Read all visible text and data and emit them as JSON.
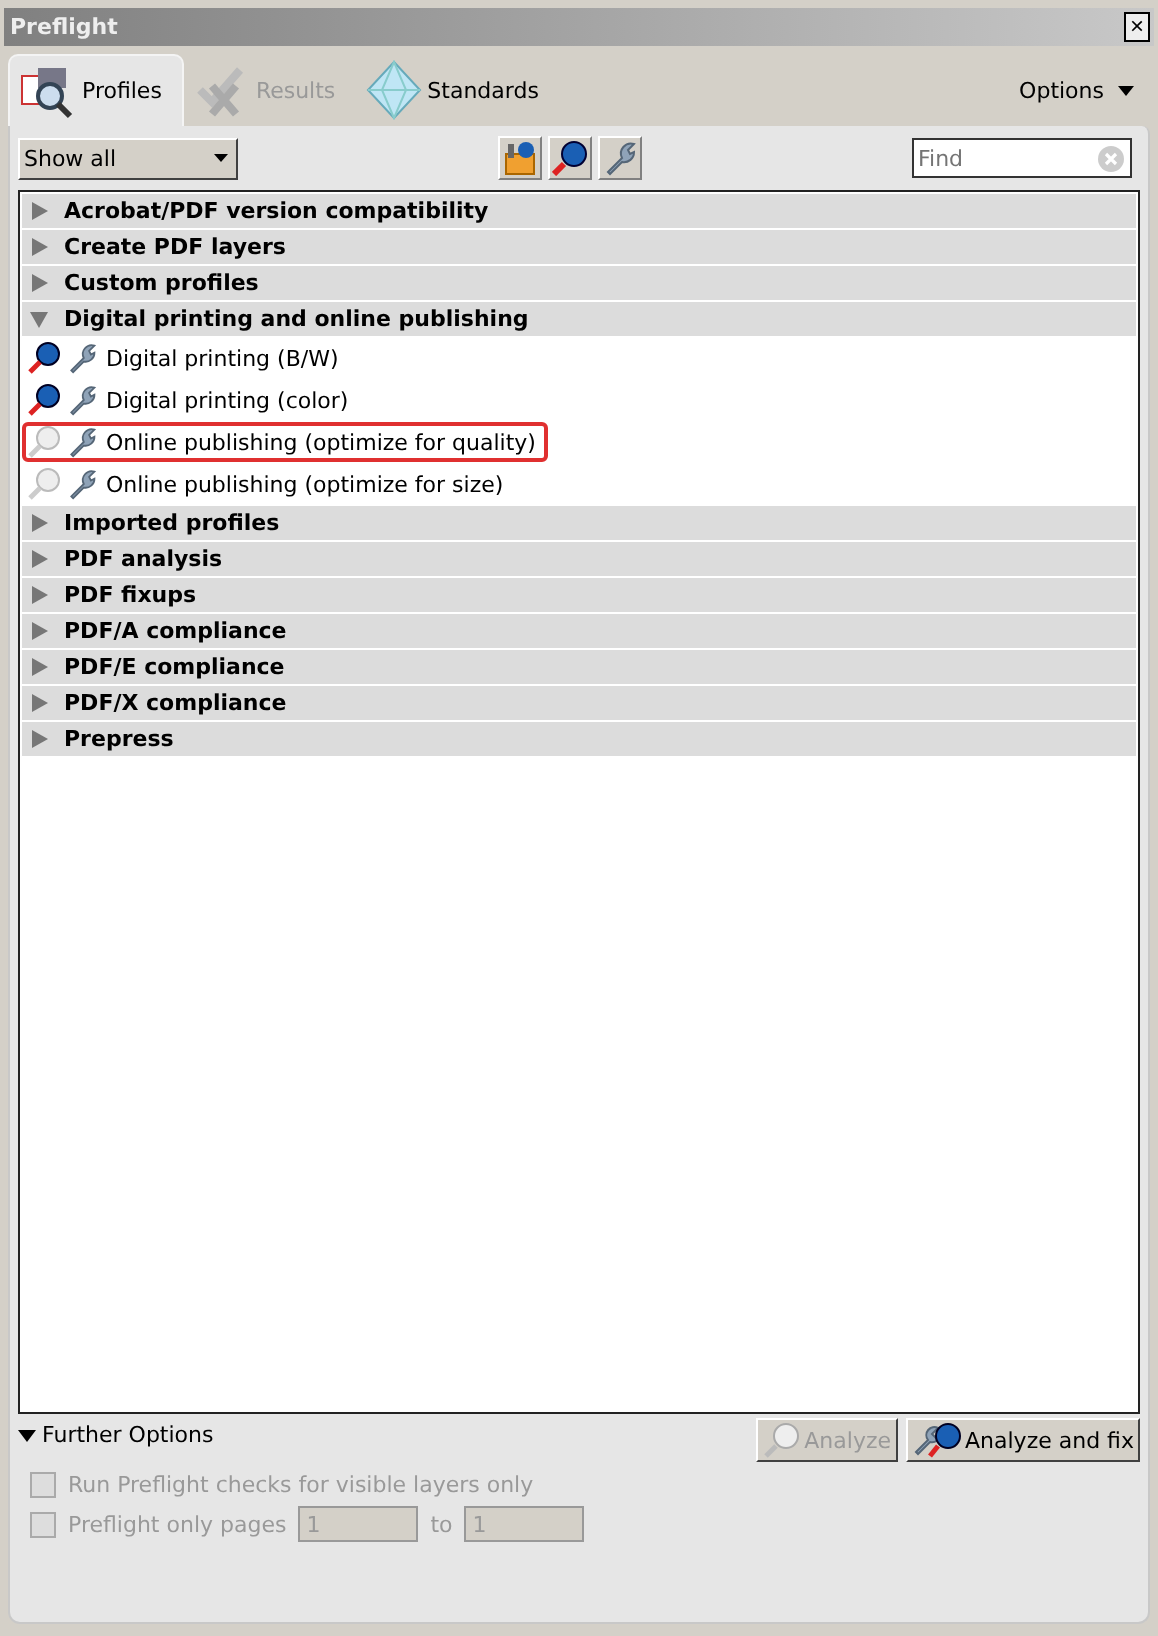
{
  "window": {
    "title": "Preflight",
    "close": "×"
  },
  "tabs": [
    {
      "label": "Profiles",
      "selected": true,
      "disabled": false
    },
    {
      "label": "Results",
      "selected": false,
      "disabled": true
    },
    {
      "label": "Standards",
      "selected": false,
      "disabled": false
    }
  ],
  "options_menu": "Options",
  "filter": {
    "value": "Show all"
  },
  "search": {
    "placeholder": "Find"
  },
  "profile_tree": [
    {
      "label": "Acrobat/PDF version compatibility",
      "expanded": false
    },
    {
      "label": "Create PDF layers",
      "expanded": false
    },
    {
      "label": "Custom profiles",
      "expanded": false
    },
    {
      "label": "Digital printing and online publishing",
      "expanded": true,
      "children": [
        {
          "label": "Digital printing (B/W)",
          "analyzable": true,
          "highlighted": false
        },
        {
          "label": "Digital printing (color)",
          "analyzable": true,
          "highlighted": false
        },
        {
          "label": "Online publishing (optimize for quality)",
          "analyzable": false,
          "highlighted": true
        },
        {
          "label": "Online publishing (optimize for size)",
          "analyzable": false,
          "highlighted": false
        }
      ]
    },
    {
      "label": "Imported profiles",
      "expanded": false
    },
    {
      "label": "PDF analysis",
      "expanded": false
    },
    {
      "label": "PDF fixups",
      "expanded": false
    },
    {
      "label": "PDF/A compliance",
      "expanded": false
    },
    {
      "label": "PDF/E compliance",
      "expanded": false
    },
    {
      "label": "PDF/X compliance",
      "expanded": false
    },
    {
      "label": "Prepress",
      "expanded": false
    }
  ],
  "further_options": {
    "label": "Further Options",
    "expanded": true
  },
  "buttons": [
    {
      "label": "Analyze",
      "disabled": true
    },
    {
      "label": "Analyze and fix",
      "disabled": false
    }
  ],
  "visible_layers_only": {
    "label": "Run Preflight checks for visible layers only",
    "checked": false,
    "disabled": true
  },
  "page_range": {
    "label": "Preflight only pages",
    "checked": false,
    "disabled": true,
    "from": "1",
    "separator": "to",
    "to": "1"
  }
}
